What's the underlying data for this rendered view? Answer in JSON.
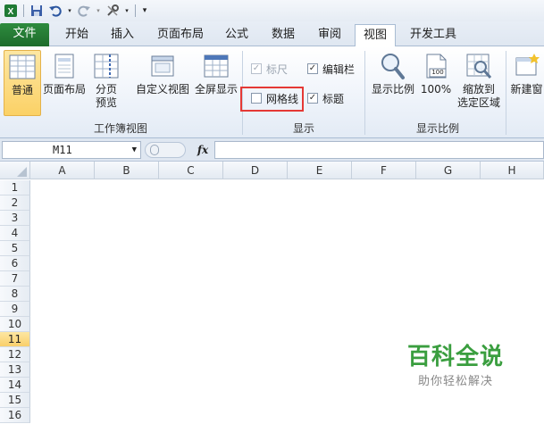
{
  "name_box": {
    "value": "M11"
  },
  "formula_bar": {
    "fx_label": "fx"
  },
  "tabs": [
    {
      "label": "文件"
    },
    {
      "label": "开始"
    },
    {
      "label": "插入"
    },
    {
      "label": "页面布局"
    },
    {
      "label": "公式"
    },
    {
      "label": "数据"
    },
    {
      "label": "审阅"
    },
    {
      "label": "视图"
    },
    {
      "label": "开发工具"
    }
  ],
  "ribbon": {
    "workbook_views": {
      "label": "工作簿视图",
      "normal": "普通",
      "page_layout": "页面布局",
      "page_break_1": "分页",
      "page_break_2": "预览",
      "custom_views": "自定义视图",
      "full_screen": "全屏显示"
    },
    "show": {
      "label": "显示",
      "ruler": "标尺",
      "formula_bar": "编辑栏",
      "gridlines": "网格线",
      "headings": "标题"
    },
    "zoom": {
      "label": "显示比例",
      "zoom": "显示比例",
      "hundred": "100%",
      "zoom_sel_1": "缩放到",
      "zoom_sel_2": "选定区域",
      "page_badge": "100"
    },
    "window": {
      "new_window": "新建窗"
    }
  },
  "columns": [
    "A",
    "B",
    "C",
    "D",
    "E",
    "F",
    "G",
    "H"
  ],
  "rows": [
    "1",
    "2",
    "3",
    "4",
    "5",
    "6",
    "7",
    "8",
    "9",
    "10",
    "11",
    "12",
    "13",
    "14",
    "15",
    "16"
  ],
  "selected_row": "11",
  "watermark": {
    "title": "百科全说",
    "subtitle": "助你轻松解决"
  },
  "colors": {
    "file_tab": "#217a34",
    "selection": "#fbd166",
    "highlight_box": "#e53935",
    "watermark": "#3a9e3f"
  }
}
